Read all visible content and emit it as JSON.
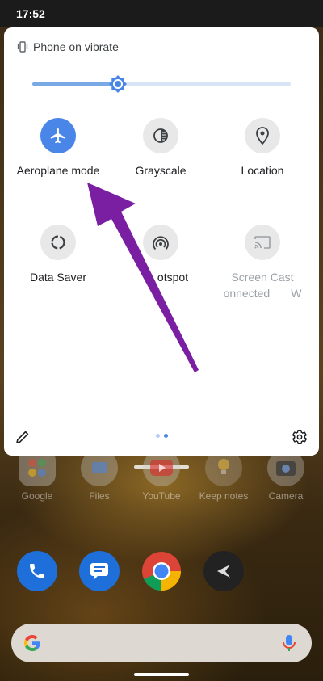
{
  "status_bar": {
    "time": "17:52"
  },
  "quick_settings": {
    "ringer_label": "Phone on vibrate",
    "brightness_level": 0.33,
    "tiles": [
      {
        "label": "Aeroplane mode",
        "sublabel": "",
        "icon": "airplane-icon",
        "active": true
      },
      {
        "label": "Grayscale",
        "sublabel": "",
        "icon": "grayscale-icon",
        "active": false
      },
      {
        "label": "Location",
        "sublabel": "",
        "icon": "location-pin-icon",
        "active": false
      },
      {
        "label": "Data Saver",
        "sublabel": "",
        "icon": "data-saver-icon",
        "active": false
      },
      {
        "label": "otspot",
        "sublabel": "",
        "icon": "hotspot-icon",
        "active": false
      },
      {
        "label": "Screen Cast",
        "sublabel": "onnected",
        "sublabel_tail": "W",
        "icon": "cast-icon",
        "active": false
      }
    ],
    "page_count": 2,
    "current_page": 2,
    "edit_icon": "pencil-icon",
    "settings_icon": "gear-icon"
  },
  "home_screen": {
    "dock_apps": [
      {
        "label": "Google",
        "icon": "google-folder-icon"
      },
      {
        "label": "Files",
        "icon": "files-icon"
      },
      {
        "label": "YouTube",
        "icon": "youtube-icon"
      },
      {
        "label": "Keep notes",
        "icon": "keep-notes-icon"
      },
      {
        "label": "Camera",
        "icon": "camera-icon"
      }
    ],
    "favorites": [
      {
        "icon": "phone-icon"
      },
      {
        "icon": "messages-icon"
      },
      {
        "icon": "chrome-icon"
      },
      {
        "icon": "app-launcher-icon"
      }
    ],
    "search_bar": {
      "left_icon": "google-g-icon",
      "right_icon": "microphone-icon"
    }
  },
  "colors": {
    "accent": "#4a86e8",
    "arrow": "#7b1fa2",
    "tile_inactive": "#e8e8e8"
  }
}
